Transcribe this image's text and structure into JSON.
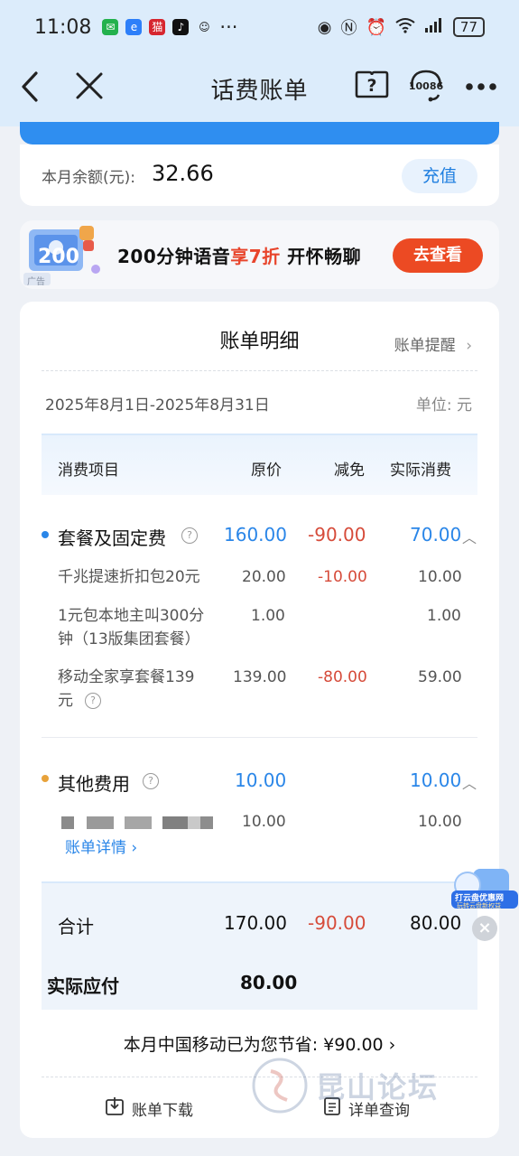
{
  "status_bar": {
    "time": "11:08",
    "more": "···",
    "battery": "77"
  },
  "nav": {
    "title": "话费账单",
    "service_number": "10086"
  },
  "balance": {
    "label": "本月余额(元):",
    "value": "32.66",
    "recharge_label": "充值"
  },
  "banner": {
    "art_text": "200",
    "tag": "广告",
    "text_before": "200分钟语音",
    "text_highlight": "享7折",
    "text_after": " 开怀畅聊",
    "button_label": "去查看"
  },
  "bill": {
    "title": "账单明细",
    "remind_label": "账单提醒",
    "period": "2025年8月1日-2025年8月31日",
    "unit": "单位: 元",
    "headers": {
      "item": "消费项目",
      "original": "原价",
      "discount": "减免",
      "actual": "实际消费"
    },
    "groups": [
      {
        "name": "套餐及固定费",
        "original": "160.00",
        "discount": "-90.00",
        "actual": "70.00",
        "dot_color": "#2a86e8",
        "items": [
          {
            "name": "千兆提速折扣包20元",
            "original": "20.00",
            "discount": "-10.00",
            "actual": "10.00"
          },
          {
            "name_line1": "1元包本地主叫300分",
            "name_line2": "钟（13版集团套餐）",
            "original": "1.00",
            "discount": "",
            "actual": "1.00"
          },
          {
            "name_line1": "移动全家享套餐139",
            "name_line2": "元",
            "original": "139.00",
            "discount": "-80.00",
            "actual": "59.00"
          }
        ]
      },
      {
        "name": "其他费用",
        "original": "10.00",
        "discount": "",
        "actual": "10.00",
        "dot_color": "#e8a23a",
        "items": [
          {
            "original": "10.00",
            "actual": "10.00",
            "detail_link": "账单详情 ›"
          }
        ]
      }
    ],
    "total": {
      "label": "合计",
      "original": "170.00",
      "discount": "-90.00",
      "actual": "80.00"
    },
    "payable": {
      "label": "实际应付",
      "value": "80.00"
    },
    "savings_text": "本月中国移动已为您节省: ¥90.00 ›",
    "download_label": "账单下载",
    "detail_query_label": "详单查询"
  },
  "float_ad": {
    "line1": "打云盘优惠网",
    "line2": "玩转云盘新权益"
  },
  "watermark": "昆山论坛",
  "colors": {
    "accent_blue": "#2a86e8",
    "discount_red": "#d64b3a",
    "banner_button": "#ec4a23"
  }
}
